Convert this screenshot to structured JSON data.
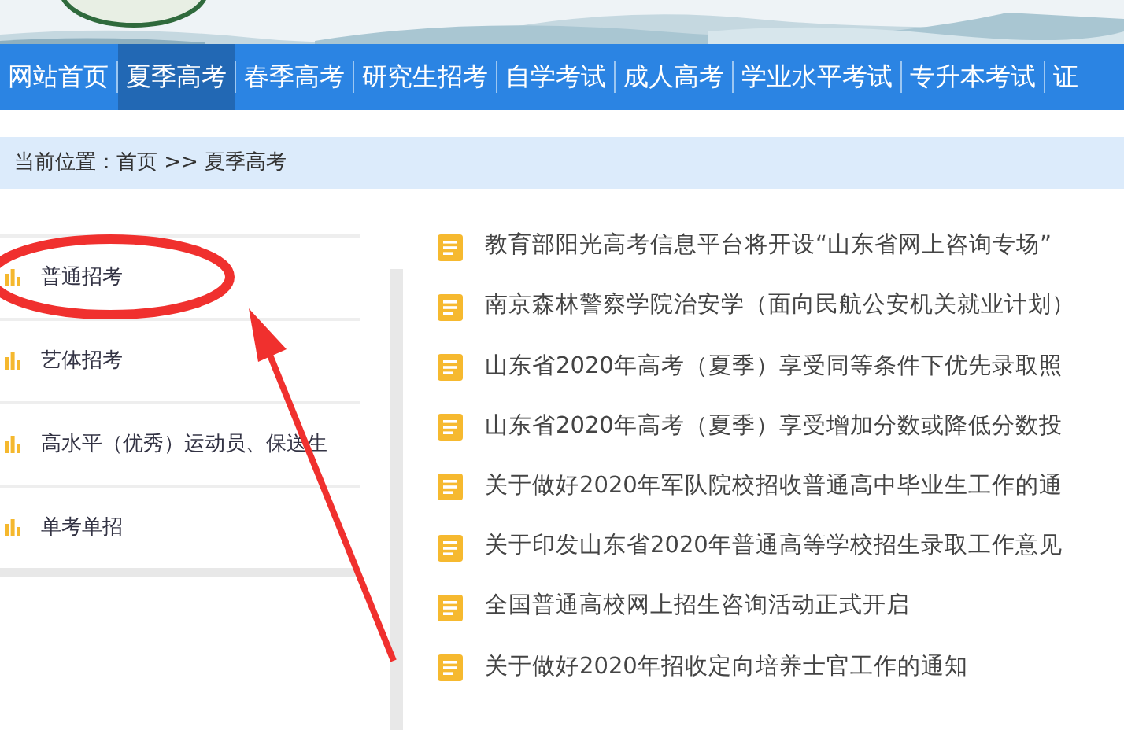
{
  "nav": [
    {
      "label": "网站首页",
      "selected": false
    },
    {
      "label": "夏季高考",
      "selected": true
    },
    {
      "label": "春季高考",
      "selected": false
    },
    {
      "label": "研究生招考",
      "selected": false
    },
    {
      "label": "自学考试",
      "selected": false
    },
    {
      "label": "成人高考",
      "selected": false
    },
    {
      "label": "学业水平考试",
      "selected": false
    },
    {
      "label": "专升本考试",
      "selected": false
    },
    {
      "label": "证",
      "selected": false
    }
  ],
  "breadcrumb": "当前位置：首页 >> 夏季高考",
  "sidebar": {
    "items": [
      "普通招考",
      "艺体招考",
      "高水平（优秀）运动员、保送生",
      "单考单招"
    ]
  },
  "news": [
    "教育部阳光高考信息平台将开设“山东省网上咨询专场”",
    "南京森林警察学院治安学（面向民航公安机关就业计划）",
    "山东省2020年高考（夏季）享受同等条件下优先录取照",
    "山东省2020年高考（夏季）享受增加分数或降低分数投",
    "关于做好2020年军队院校招收普通高中毕业生工作的通",
    "关于印发山东省2020年普通高等学校招生录取工作意见",
    "全国普通高校网上招生咨询活动正式开启",
    "关于做好2020年招收定向培养士官工作的通知"
  ]
}
